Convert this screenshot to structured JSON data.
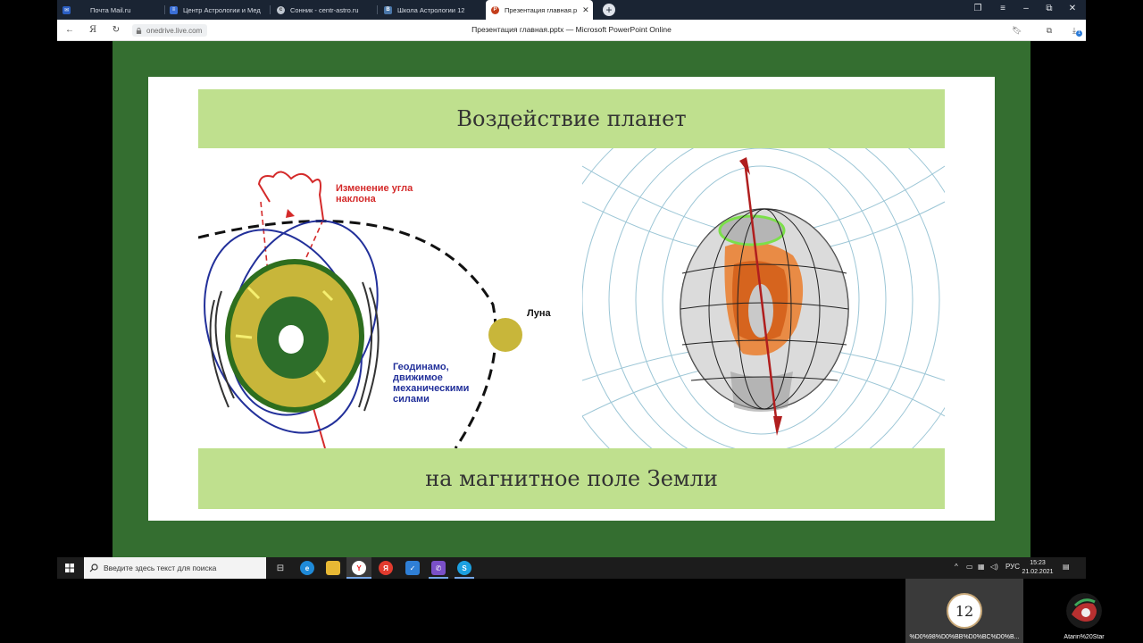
{
  "browser": {
    "tabs": [
      {
        "label": "Почта Mail.ru",
        "icon": "mail-icon",
        "color": "#2b5ec2"
      },
      {
        "label": "Центр Астрологии и Мед",
        "icon": "document-icon",
        "color": "#3b6fd6"
      },
      {
        "label": "Сонник - centr-astro.ru",
        "icon": "site-icon",
        "color": "#bfc6d0"
      },
      {
        "label": "Школа Астрологии 12",
        "icon": "vk-icon",
        "color": "#4a76a8"
      },
      {
        "label": "Презентация главная.p",
        "icon": "powerpoint-icon",
        "color": "#c43e1c"
      }
    ],
    "new_tab_symbol": "+",
    "address": {
      "url": "onedrive.live.com",
      "page_title": "Презентация главная.pptx — Microsoft PowerPoint Online",
      "downloads_badge": "1"
    }
  },
  "slide": {
    "title": "Воздействие планет",
    "subtitle": "на магнитное поле Земли",
    "left_picture": {
      "label_tilt": [
        "Изменение угла",
        "наклона"
      ],
      "label_moon": "Луна",
      "label_geodynamo": [
        "Геодинамо,",
        "движимое",
        "механическими",
        "силами"
      ]
    }
  },
  "taskbar": {
    "search_placeholder": "Введите здесь текст для поиска",
    "language": "РУС",
    "time": "15:23",
    "date": "21.02.2021"
  },
  "participants": [
    {
      "name": "%D0%98%D0%BB%D0%BC%D0%B...",
      "avatar_text": "12"
    },
    {
      "name": "Atarin%20Star"
    }
  ],
  "colors": {
    "stage_green": "#346e30",
    "band_green": "#bfe08e",
    "taskbar": "#1c1c1c",
    "tabbar": "#1a2433"
  }
}
